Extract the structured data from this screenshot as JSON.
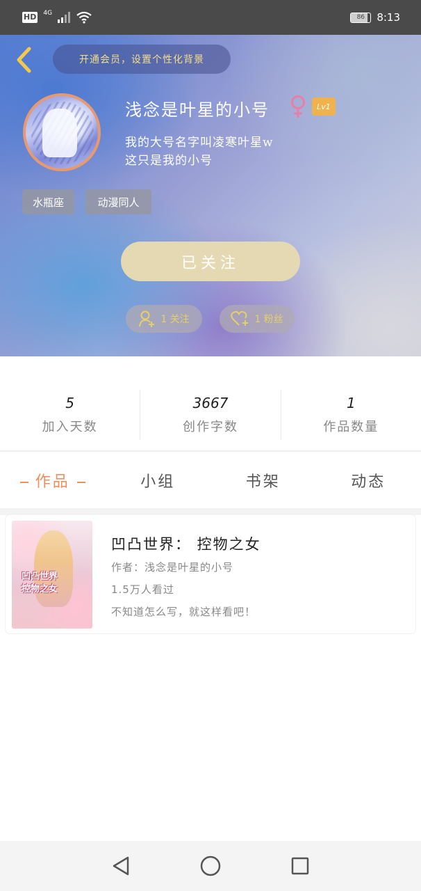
{
  "status_bar": {
    "hd": "HD",
    "network": "4G",
    "battery": "86",
    "battery_level": 0.86,
    "time": "8:13"
  },
  "header": {
    "vip_banner": "开通会员，设置个性化背景",
    "user_name": "浅念是叶星的小号",
    "level": "Lv1",
    "bio": "我的大号名字叫凌寒叶星w\n这只是我的小号",
    "tags": [
      "水瓶座",
      "动漫同人"
    ],
    "follow_button": "已关注",
    "following_count": "1 关注",
    "fans_count": "1 粉丝"
  },
  "stats": [
    {
      "value": "5",
      "label": "加入天数"
    },
    {
      "value": "3667",
      "label": "创作字数"
    },
    {
      "value": "1",
      "label": "作品数量"
    }
  ],
  "tabs": [
    {
      "label": "作品",
      "active": true
    },
    {
      "label": "小组",
      "active": false
    },
    {
      "label": "书架",
      "active": false
    },
    {
      "label": "动态",
      "active": false
    }
  ],
  "works": [
    {
      "cover_text": "凹凸世界\n控物之女",
      "title": "凹凸世界： 控物之女",
      "author": "作者：浅念是叶星的小号",
      "views": "1.5万人看过",
      "description": "不知道怎么写，就这样看吧！"
    }
  ],
  "colors": {
    "accent": "#ee8f5c",
    "follow_button": "#e5d9b3",
    "vip_text": "#f3dd8c",
    "level_badge": "#f0b24d",
    "gender_icon": "#e87fa8"
  },
  "icons": {
    "back": "chevron-left-icon",
    "gender": "female-icon",
    "following": "add-user-icon",
    "fans": "heart-plus-icon",
    "nav_back": "triangle-back-icon",
    "nav_home": "circle-home-icon",
    "nav_recent": "square-recent-icon"
  }
}
